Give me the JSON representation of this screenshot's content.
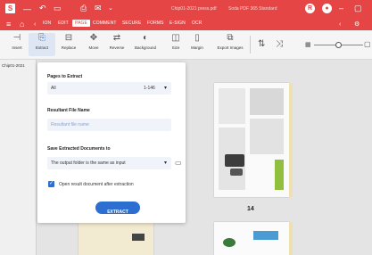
{
  "titlebar": {
    "filename": "Chip01-2021 press.pdf",
    "app_name": "Soda PDF 365 Standard"
  },
  "menu": {
    "items": [
      "ION",
      "EDIT",
      "PAGE",
      "COMMENT",
      "SECURE",
      "FORMS",
      "E-SIGN",
      "OCR"
    ],
    "active": "PAGE"
  },
  "toolbar": {
    "items": [
      "Insert",
      "Extract",
      "Replace",
      "Move",
      "Reverse",
      "Background",
      "Size",
      "Margin",
      "Export Images"
    ],
    "active": "Extract"
  },
  "sidebar": {
    "tab_label": "Chip01-2021"
  },
  "dialog": {
    "pages_label": "Pages to Extract",
    "pages_value": "All",
    "pages_range": "1-146",
    "result_label": "Resultant File Name",
    "result_placeholder": "Resultant file name",
    "save_label": "Save Extracted Documents to",
    "save_value": "The output folder is the same as input",
    "checkbox_label": "Open result document after extraction",
    "checkbox_checked": true,
    "extract_button": "EXTRACT"
  },
  "content": {
    "page_number": "14"
  },
  "colors": {
    "brand": "#e64545",
    "accent": "#2c6fd1"
  }
}
